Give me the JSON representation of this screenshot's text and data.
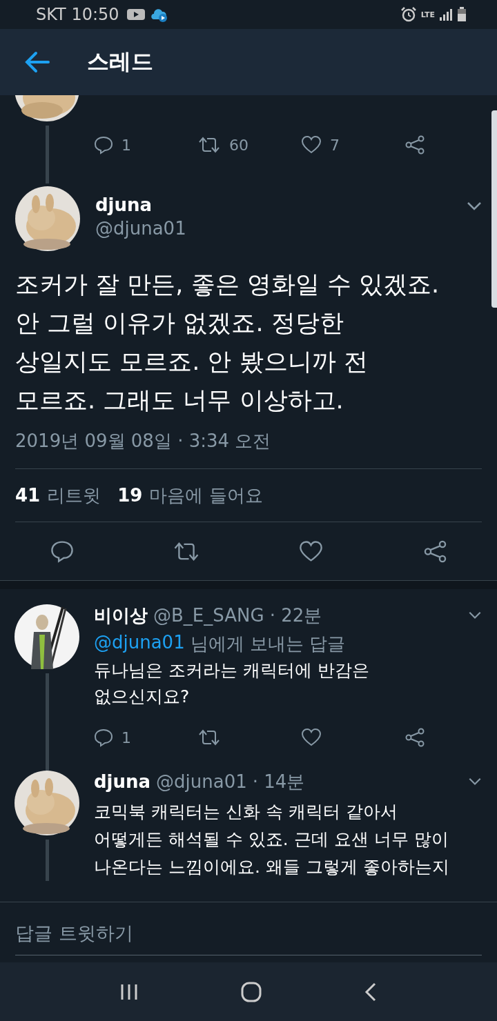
{
  "status_bar": {
    "carrier_time": "SKT 10:50",
    "network": "LTE"
  },
  "header": {
    "title": "스레드"
  },
  "previous_tweet": {
    "actions": [
      {
        "kind": "reply",
        "count": "1"
      },
      {
        "kind": "retweet",
        "count": "60"
      },
      {
        "kind": "like",
        "count": "7"
      },
      {
        "kind": "share"
      }
    ]
  },
  "main_tweet": {
    "name": "djuna",
    "handle": "@djuna01",
    "text_lines": [
      "조커가 잘 만든, 좋은 영화일 수 있겠죠.",
      "안 그럴 이유가 없겠죠. 정당한",
      "상일지도 모르죠. 안 봤으니까 전",
      "모르죠. 그래도 너무 이상하고."
    ],
    "timestamp": "2019년 09월 08일 · 3:34 오전",
    "stats": [
      {
        "count": "41",
        "label": "리트윗"
      },
      {
        "count": "19",
        "label": "마음에 들어요"
      }
    ],
    "actions": [
      {
        "kind": "reply"
      },
      {
        "kind": "retweet"
      },
      {
        "kind": "like"
      },
      {
        "kind": "share"
      }
    ]
  },
  "replies": [
    {
      "name": "비이상",
      "handle": "@B_E_SANG",
      "time": "· 22분",
      "reply_to": "@djuna01",
      "reply_to_suffix": "님에게 보내는 답글",
      "text_lines": [
        "듀나님은 조커라는 캐릭터에 반감은",
        "없으신지요?"
      ],
      "actions": [
        {
          "kind": "reply",
          "count": "1"
        },
        {
          "kind": "retweet"
        },
        {
          "kind": "like"
        },
        {
          "kind": "share"
        }
      ]
    },
    {
      "name": "djuna",
      "handle": "@djuna01",
      "time": "· 14분",
      "text_lines": [
        "코믹북 캐릭터는 신화 속 캐릭터 같아서",
        "어떻게든 해석될 수 있죠. 근데 요샌 너무 많이",
        "나온다는 느낌이에요. 왜들 그렇게 좋아하는지"
      ]
    }
  ],
  "composer": {
    "placeholder": "답글 트윗하기"
  }
}
